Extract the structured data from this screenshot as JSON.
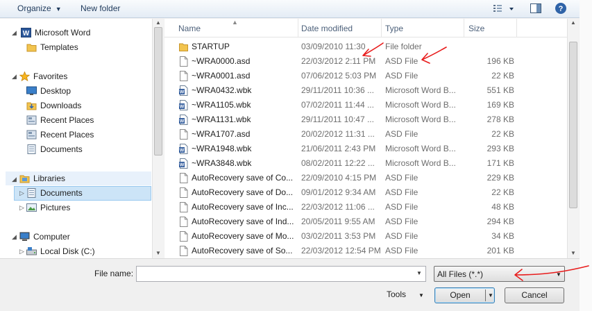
{
  "toolbar": {
    "organize_label": "Organize",
    "new_folder_label": "New folder"
  },
  "nav": {
    "items": [
      {
        "label": "Microsoft Word",
        "icon": "word-icon"
      },
      {
        "label": "Templates",
        "icon": "folder-icon"
      },
      {
        "label": "Favorites",
        "icon": "star-icon"
      },
      {
        "label": "Desktop",
        "icon": "desktop-icon"
      },
      {
        "label": "Downloads",
        "icon": "downloads-folder-icon"
      },
      {
        "label": "Recent Places",
        "icon": "recent-places-icon"
      },
      {
        "label": "Recent Places",
        "icon": "recent-places-icon"
      },
      {
        "label": "Documents",
        "icon": "documents-icon"
      },
      {
        "label": "Libraries",
        "icon": "libraries-icon"
      },
      {
        "label": "Documents",
        "icon": "documents-icon"
      },
      {
        "label": "Pictures",
        "icon": "pictures-icon"
      },
      {
        "label": "Computer",
        "icon": "computer-icon"
      },
      {
        "label": "Local Disk (C:)",
        "icon": "disk-icon"
      }
    ],
    "selected_item": "Documents"
  },
  "columns": {
    "name": "Name",
    "date": "Date modified",
    "type": "Type",
    "size": "Size"
  },
  "files": [
    {
      "name": "STARTUP",
      "date": "03/09/2010 11:30",
      "type": "File folder",
      "size": "",
      "icon": "folder-icon"
    },
    {
      "name": "~WRA0000.asd",
      "date": "22/03/2012 2:11 PM",
      "type": "ASD File",
      "size": "196 KB",
      "icon": "blank-file-icon"
    },
    {
      "name": "~WRA0001.asd",
      "date": "07/06/2012 5:03 PM",
      "type": "ASD File",
      "size": "22 KB",
      "icon": "blank-file-icon"
    },
    {
      "name": "~WRA0432.wbk",
      "date": "29/11/2011 10:36 ...",
      "type": "Microsoft Word B...",
      "size": "551 KB",
      "icon": "word-file-icon"
    },
    {
      "name": "~WRA1105.wbk",
      "date": "07/02/2011 11:44 ...",
      "type": "Microsoft Word B...",
      "size": "169 KB",
      "icon": "word-file-icon"
    },
    {
      "name": "~WRA1131.wbk",
      "date": "29/11/2011 10:47 ...",
      "type": "Microsoft Word B...",
      "size": "278 KB",
      "icon": "word-file-icon"
    },
    {
      "name": "~WRA1707.asd",
      "date": "20/02/2012 11:31 ...",
      "type": "ASD File",
      "size": "22 KB",
      "icon": "blank-file-icon"
    },
    {
      "name": "~WRA1948.wbk",
      "date": "21/06/2011 2:43 PM",
      "type": "Microsoft Word B...",
      "size": "293 KB",
      "icon": "word-file-icon"
    },
    {
      "name": "~WRA3848.wbk",
      "date": "08/02/2011 12:22 ...",
      "type": "Microsoft Word B...",
      "size": "171 KB",
      "icon": "word-file-icon"
    },
    {
      "name": "AutoRecovery save of Co...",
      "date": "22/09/2010 4:15 PM",
      "type": "ASD File",
      "size": "229 KB",
      "icon": "blank-file-icon"
    },
    {
      "name": "AutoRecovery save of Do...",
      "date": "09/01/2012 9:34 AM",
      "type": "ASD File",
      "size": "22 KB",
      "icon": "blank-file-icon"
    },
    {
      "name": "AutoRecovery save of Inc...",
      "date": "22/03/2012 11:06 ...",
      "type": "ASD File",
      "size": "48 KB",
      "icon": "blank-file-icon"
    },
    {
      "name": "AutoRecovery save of Ind...",
      "date": "20/05/2011 9:55 AM",
      "type": "ASD File",
      "size": "294 KB",
      "icon": "blank-file-icon"
    },
    {
      "name": "AutoRecovery save of Mo...",
      "date": "03/02/2011 3:53 PM",
      "type": "ASD File",
      "size": "34 KB",
      "icon": "blank-file-icon"
    },
    {
      "name": "AutoRecovery save of So...",
      "date": "22/03/2012 12:54 PM",
      "type": "ASD File",
      "size": "201 KB",
      "icon": "blank-file-icon"
    }
  ],
  "bottom": {
    "file_name_label": "File name:",
    "file_name_value": "",
    "filter_value": "All Files (*.*)",
    "tools_label": "Tools",
    "open_label": "Open",
    "cancel_label": "Cancel"
  },
  "colors": {
    "annotation": "#e81c1c",
    "selection": "#cce4f7",
    "toolbar_text": "#1e395b"
  }
}
